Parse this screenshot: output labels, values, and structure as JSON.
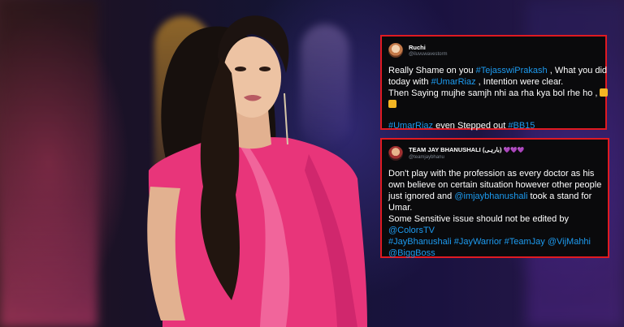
{
  "tweets": [
    {
      "name": "Ruchi",
      "handle": "@iluvuwavestorm",
      "lines": [
        [
          "Really Shame on you ",
          "#TejasswiPrakash",
          " , What you did"
        ],
        [
          "today with ",
          "#UmarRiaz",
          " , Intention were clear."
        ],
        [
          "Then Saying mujhe samjh nhi aa rha kya bol rhe ho ,"
        ]
      ],
      "footer": [
        "#UmarRiaz",
        " even Stepped out ",
        "#BB15"
      ]
    },
    {
      "name": "TEAM JAY BHANUSHALI (بارہی)",
      "name_hearts": "💜💜💜",
      "handle": "@teamjaybhanu",
      "lines": [
        "Don't play with the profession as every doctor as his",
        "own believe on certain situation however other people",
        [
          "just ignored and ",
          "@imjaybhanushali",
          " took a stand for"
        ],
        "Umar.",
        "Some Sensitive issue should not be edited by",
        [
          "@ColorsTV"
        ],
        [
          "#JayBhanushali #JayWarrior #TeamJay @VijMahhi"
        ],
        [
          "@BiggBoss"
        ]
      ]
    }
  ],
  "colors": {
    "accent_border": "#e01a22",
    "hashtag": "#1d9bf0",
    "dress": "#e8357a"
  }
}
